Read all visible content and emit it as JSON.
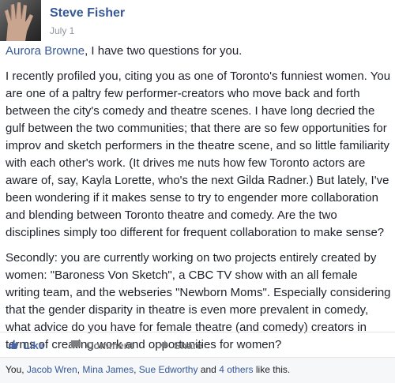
{
  "post": {
    "author": "Steve Fisher",
    "date": "July 1",
    "mention": "Aurora Browne",
    "intro": ", I have two questions for you.",
    "paragraph1": "I recently profiled you, citing you as one of Toronto's funniest women. You are one of a paltry few performer-creators who move back and forth between the city's comedy and theatre scenes. I have long decried the gulf between the two communities; that there are so few opportunities for improv and sketch performers in the theatre scene, and so little familiarity with each other's work. (It drives me nuts how few Toronto actors are aware of, say, Kayla Lorette, who's the next Gilda Radner.) But lately, I've been wondering if it makes sense to try to engender more collaboration and blending between Toronto theatre and comedy. Are the two disciplines simply too different for frequent collaboration to make sense?",
    "paragraph2": "Secondly: you are currently working on two projects entirely created by women: \"Baroness Von Sketch\", a CBC TV show with an all female writing team, and the webseries \"Newborn Moms\". Especially considering that the gender disparity in theatre is even more prevalent in comedy, what advice do you have for female theatre (and comedy) creators in terms of creating work and opportunities for women?"
  },
  "actions": {
    "like": "Like",
    "comment": "Comment",
    "share": "Share",
    "like_icon": "thumbs-up-icon",
    "comment_icon": "comment-icon",
    "share_icon": "share-arrow-icon"
  },
  "likes": {
    "you": "You",
    "sep1": ", ",
    "person1": "Jacob Wren",
    "sep2": ", ",
    "person2": "Mina James",
    "sep3": ", ",
    "person3": "Sue Edworthy",
    "and": " and ",
    "others": "4 others",
    "suffix": " like this."
  },
  "colors": {
    "link": "#365899",
    "text": "#1d2129",
    "muted": "#90949c",
    "action": "#7f7f7f"
  }
}
